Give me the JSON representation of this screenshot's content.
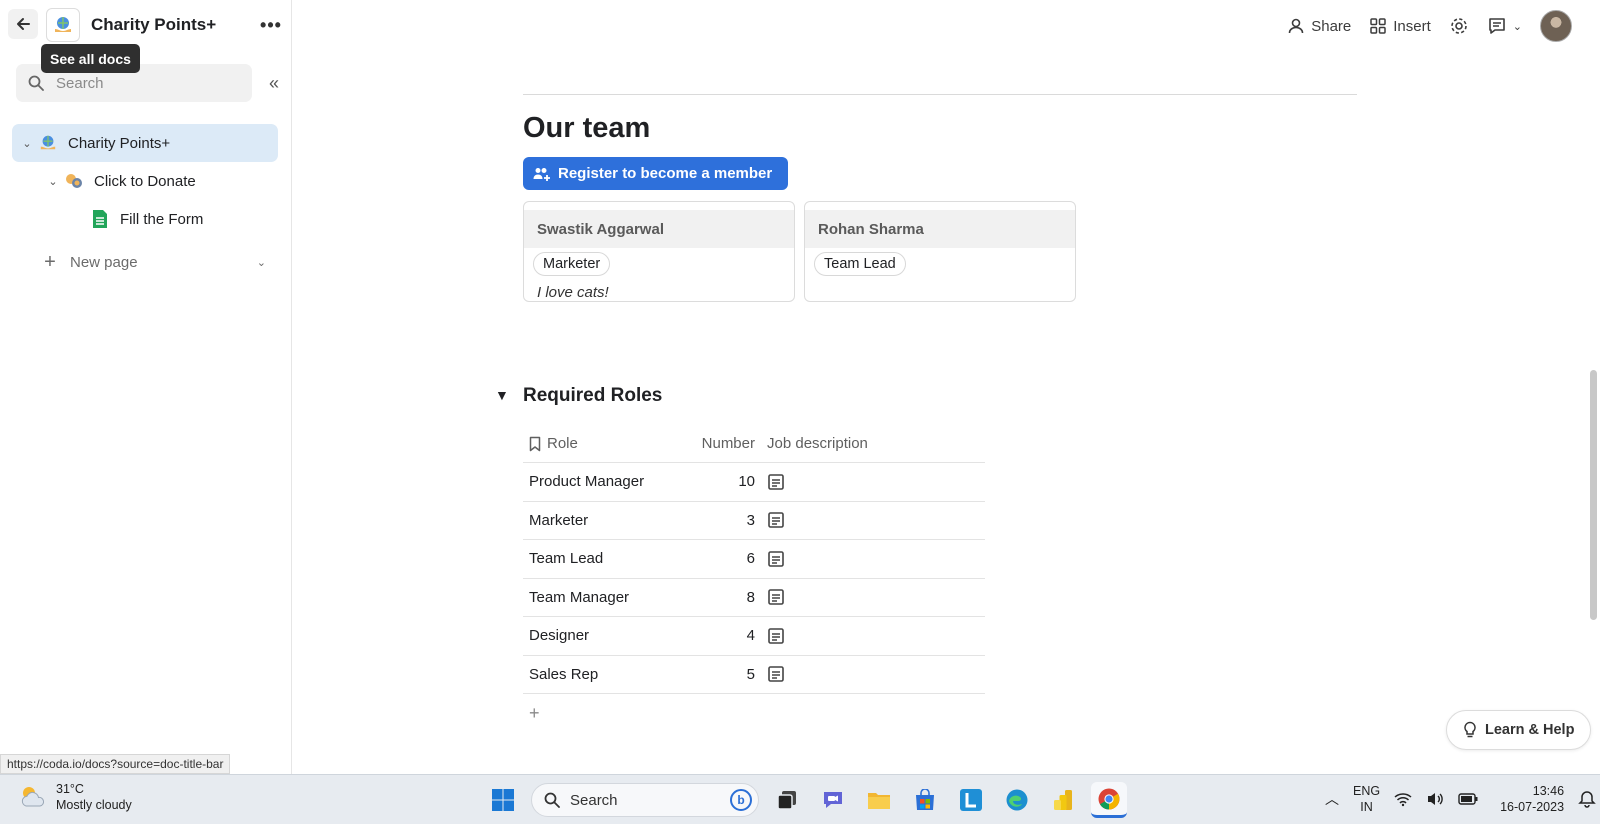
{
  "sidebar": {
    "doc_title": "Charity Points+",
    "tooltip": "See all docs",
    "search_placeholder": "Search",
    "items": [
      {
        "label": "Charity Points+"
      },
      {
        "label": "Click to Donate"
      },
      {
        "label": "Fill the Form"
      }
    ],
    "new_page": "New page"
  },
  "topbar": {
    "share": "Share",
    "insert": "Insert"
  },
  "main": {
    "heading": "Our team",
    "register_button": "Register to become a member",
    "cards": [
      {
        "name": "Swastik Aggarwal",
        "role": "Marketer",
        "quote": "I love cats!"
      },
      {
        "name": "Rohan Sharma",
        "role": "Team Lead",
        "quote": ""
      }
    ],
    "roles_heading": "Required Roles",
    "table": {
      "headers": {
        "role": "Role",
        "number": "Number",
        "description": "Job description"
      },
      "rows": [
        {
          "role": "Product Manager",
          "number": "10"
        },
        {
          "role": "Marketer",
          "number": "3"
        },
        {
          "role": "Team Lead",
          "number": "6"
        },
        {
          "role": "Team Manager",
          "number": "8"
        },
        {
          "role": "Designer",
          "number": "4"
        },
        {
          "role": "Sales Rep",
          "number": "5"
        }
      ],
      "add": "+"
    },
    "learn_help": "Learn & Help"
  },
  "status_url": "https://coda.io/docs?source=doc-title-bar",
  "taskbar": {
    "weather_temp": "31°C",
    "weather_desc": "Mostly cloudy",
    "search": "Search",
    "lang_1": "ENG",
    "lang_2": "IN",
    "time": "13:46",
    "date": "16-07-2023"
  },
  "colors": {
    "accent": "#2e70db",
    "active_nav": "#dceaf7"
  }
}
